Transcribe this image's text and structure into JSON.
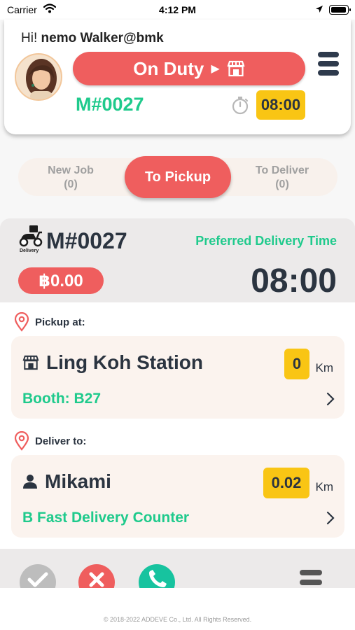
{
  "status_bar": {
    "carrier": "Carrier",
    "time": "4:12 PM"
  },
  "header": {
    "greeting_prefix": "Hi!",
    "user_name": "nemo Walker@bmk",
    "duty_label": "On Duty",
    "order_no": "M#0027",
    "time_badge": "08:00"
  },
  "tabs": [
    {
      "label": "New Job",
      "count": "(0)"
    },
    {
      "label": "To Pickup"
    },
    {
      "label": "To Deliver",
      "count": "(0)"
    }
  ],
  "order": {
    "type_label": "Delivery",
    "id": "M#0027",
    "preferred_label": "Preferred Delivery Time",
    "price": "฿0.00",
    "preferred_time": "08:00"
  },
  "pickup": {
    "section_label": "Pickup at:",
    "name": "Ling Koh Station",
    "sub": "Booth: B27",
    "distance": "0",
    "unit": "Km"
  },
  "deliver": {
    "section_label": "Deliver to:",
    "name": "Mikami",
    "sub": "B Fast Delivery Counter",
    "distance": "0.02",
    "unit": "Km"
  },
  "footer": {
    "copyright": "© 2018-2022 ADDEVE Co., Ltd. All Rights Reserved."
  },
  "colors": {
    "accent_red": "#ef5e5e",
    "accent_green": "#1fca8c",
    "badge_yellow": "#f9c514",
    "text_dark": "#2b3440"
  },
  "icons": [
    "wifi-icon",
    "location-arrow-icon",
    "battery-icon",
    "store-icon",
    "menu-icon",
    "stopwatch-icon",
    "scooter-icon",
    "map-pin-icon",
    "person-icon",
    "chevron-right-icon",
    "check-icon",
    "close-icon",
    "phone-icon"
  ]
}
